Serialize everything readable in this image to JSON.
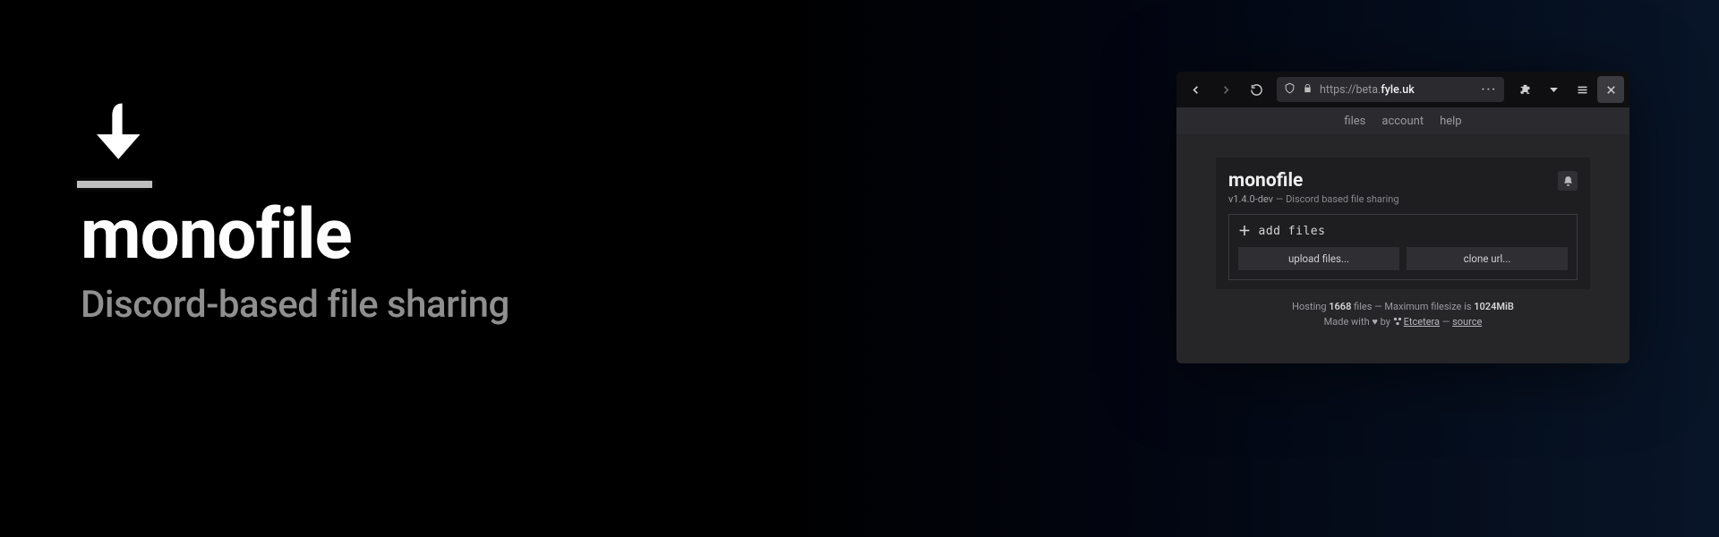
{
  "hero": {
    "title": "monofile",
    "subtitle": "Discord-based file sharing"
  },
  "browser": {
    "url_scheme": "https://",
    "url_sub": "beta.",
    "url_host": "fyle.uk"
  },
  "nav": {
    "files": "files",
    "account": "account",
    "help": "help"
  },
  "card": {
    "title": "monofile",
    "version": "v1.4.0-dev",
    "sep": "  —  ",
    "tagline": "Discord based file sharing"
  },
  "dropzone": {
    "label": "add files",
    "upload": "upload files...",
    "clone": "clone url..."
  },
  "footer": {
    "hosting_pre": "Hosting ",
    "file_count": "1668",
    "hosting_mid": " files — Maximum filesize is ",
    "max_size": "1024MiB",
    "made_pre": "Made with ",
    "made_by": " by ",
    "author": "Etcetera",
    "dash": " — ",
    "source": "source"
  }
}
